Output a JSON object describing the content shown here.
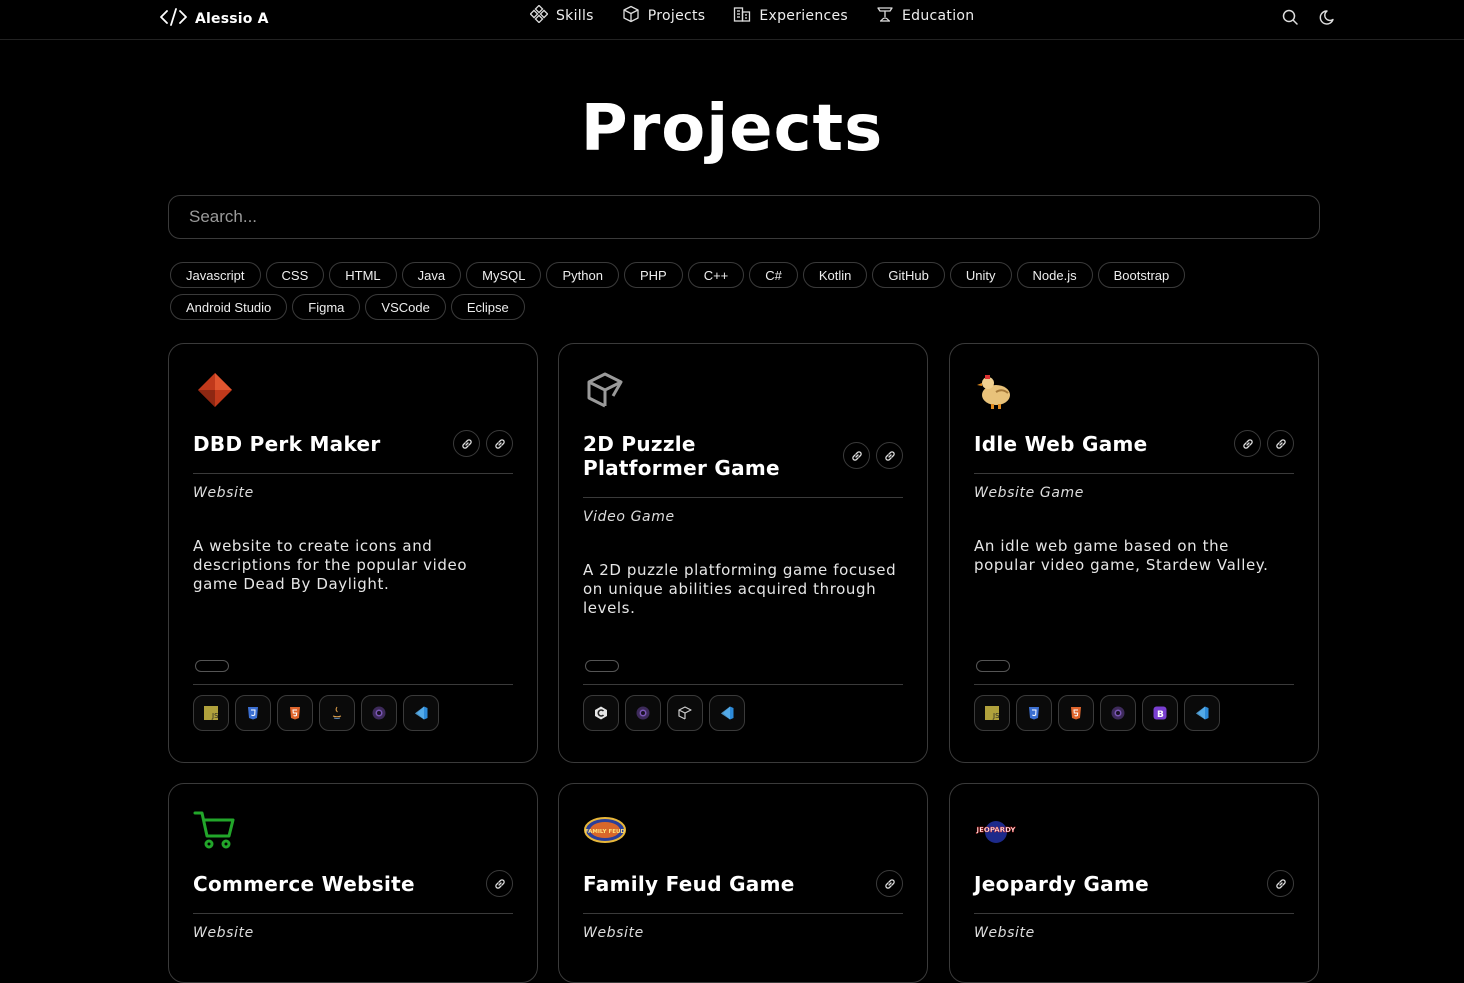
{
  "brand": {
    "name": "Alessio A"
  },
  "nav": {
    "links": [
      {
        "label": "Skills",
        "icon": "skills-icon"
      },
      {
        "label": "Projects",
        "icon": "cube-icon"
      },
      {
        "label": "Experiences",
        "icon": "buildings-icon"
      },
      {
        "label": "Education",
        "icon": "graduation-icon"
      }
    ],
    "right_icons": [
      "search-icon",
      "moon-icon"
    ]
  },
  "page": {
    "title": "Projects"
  },
  "search": {
    "placeholder": "Search..."
  },
  "tags": [
    "Javascript",
    "CSS",
    "HTML",
    "Java",
    "MySQL",
    "Python",
    "PHP",
    "C++",
    "C#",
    "Kotlin",
    "GitHub",
    "Unity",
    "Node.js",
    "Bootstrap",
    "Android Studio",
    "Figma",
    "VSCode",
    "Eclipse"
  ],
  "projects": [
    {
      "title": "DBD Perk Maker",
      "category": "Website",
      "description": "A website to create icons and descriptions for the popular video game Dead By Daylight.",
      "logo": "dbd-perk-icon",
      "links": [
        "link-icon",
        "link-icon"
      ],
      "techs": [
        "javascript-icon",
        "css-icon",
        "html-icon",
        "java-icon",
        "github-icon",
        "vscode-icon"
      ]
    },
    {
      "title": "2D Puzzle Platformer Game",
      "category": "Video Game",
      "description": "A 2D puzzle platforming game focused on unique abilities acquired through levels.",
      "logo": "unity-logo-icon",
      "links": [
        "link-icon",
        "link-icon"
      ],
      "techs": [
        "csharp-icon",
        "github-icon",
        "unity-icon",
        "vscode-icon"
      ]
    },
    {
      "title": "Idle Web Game",
      "category": "Website Game",
      "description": "An idle web game based on the popular video game, Stardew Valley.",
      "logo": "chicken-icon",
      "links": [
        "link-icon",
        "link-icon"
      ],
      "techs": [
        "javascript-icon",
        "css-icon",
        "html-icon",
        "github-icon",
        "bootstrap-icon",
        "vscode-icon"
      ]
    },
    {
      "title": "Commerce Website",
      "category": "Website",
      "logo": "cart-icon",
      "links": [
        "link-icon"
      ]
    },
    {
      "title": "Family Feud Game",
      "category": "Website",
      "logo": "family-feud-logo-icon",
      "links": [
        "link-icon"
      ]
    },
    {
      "title": "Jeopardy Game",
      "category": "Website",
      "logo": "jeopardy-logo-icon",
      "links": [
        "link-icon"
      ]
    }
  ],
  "logo_text": {
    "js": "JS",
    "bootstrap": "B",
    "family_feud": "FAMILY FEUD",
    "jeopardy": "JEOPARDY"
  },
  "colors": {
    "background": "#000000",
    "border": "#3a3a3a",
    "text": "#ffffff",
    "cart": "#22a62a",
    "dbd": "#c0391b"
  }
}
